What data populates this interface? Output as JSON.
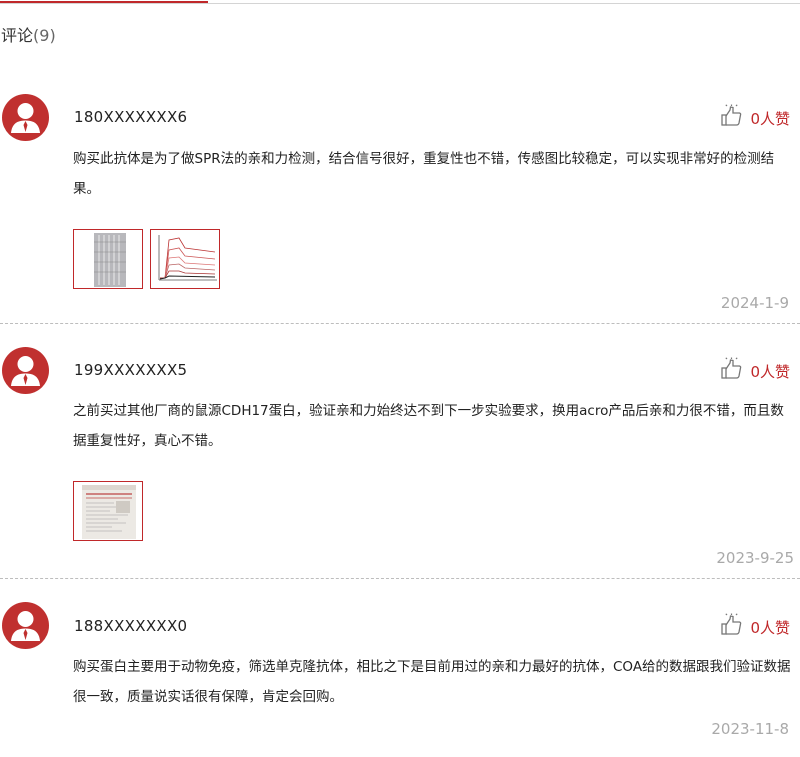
{
  "section": {
    "title": "评论",
    "count": "(9)"
  },
  "comments": [
    {
      "user": "180XXXXXXX6",
      "likes": "0人赞",
      "text": "购买此抗体是为了做SPR法的亲和力检测，结合信号很好，重复性也不错，传感图比较稳定，可以实现非常好的检测结果。",
      "date": "2024-1-9"
    },
    {
      "user": "199XXXXXXX5",
      "likes": "0人赞",
      "text": "之前买过其他厂商的鼠源CDH17蛋白，验证亲和力始终达不到下一步实验要求，换用acro产品后亲和力很不错，而且数据重复性好，真心不错。",
      "date": "2023-9-25"
    },
    {
      "user": "188XXXXXXX0",
      "likes": "0人赞",
      "text": "购买蛋白主要用于动物免疫，筛选单克隆抗体，相比之下是目前用过的亲和力最好的抗体，COA给的数据跟我们验证数据很一致，质量说实话很有保障，肯定会回购。",
      "date": "2023-11-8"
    }
  ],
  "colors": {
    "accent": "#c0282a",
    "date": "#a9a9a9",
    "divider": "#bdbdbd"
  },
  "icons": {
    "avatar": "user-avatar-icon",
    "like": "thumbs-up-icon"
  }
}
